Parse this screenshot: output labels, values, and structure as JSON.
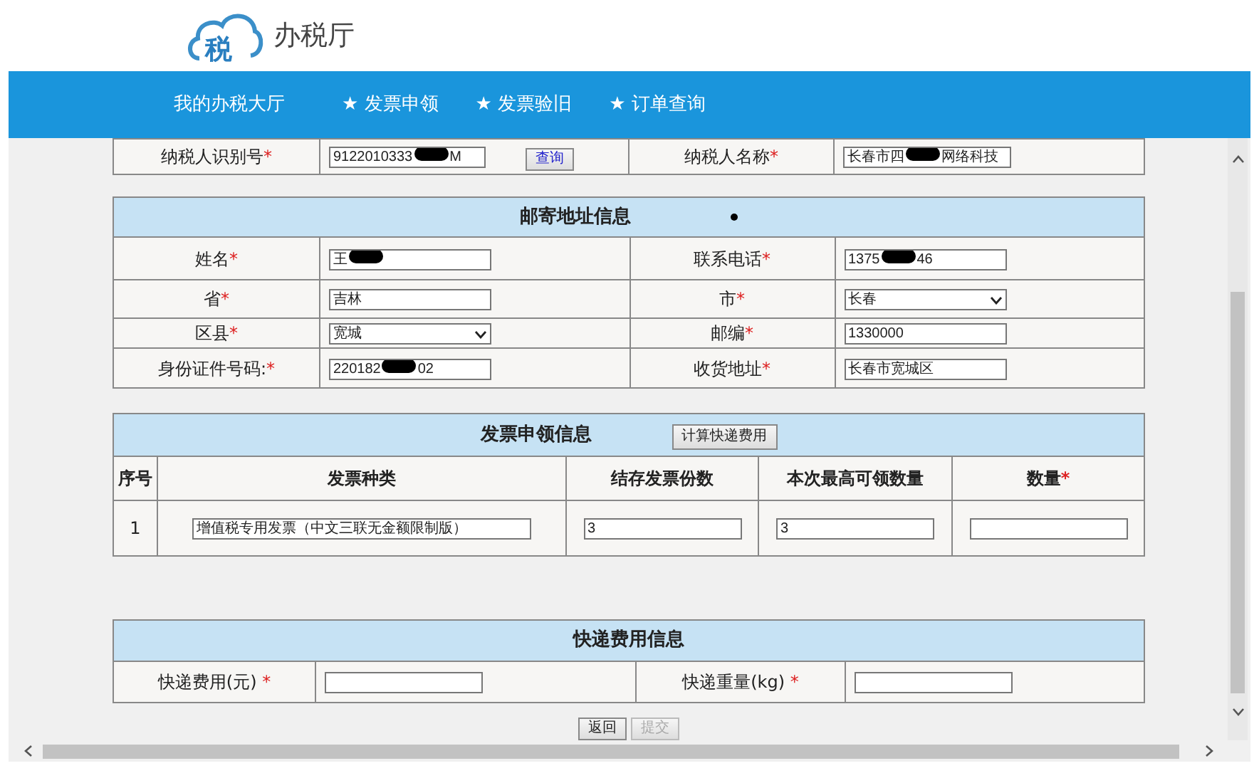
{
  "header": {
    "logo_glyph": "税",
    "title": "办税厅"
  },
  "nav": [
    {
      "label": "我的办税大厅"
    },
    {
      "star": "★",
      "label": "发票申领"
    },
    {
      "star": "★",
      "label": "发票验旧"
    },
    {
      "star": "★",
      "label": "订单查询"
    }
  ],
  "taxpayer": [
    {
      "label": "纳税人识别号",
      "mark": "*",
      "kind": "input",
      "value": [
        "9122010333",
        "M"
      ],
      "button": "查询"
    },
    {
      "label": "纳税人名称",
      "mark": "*",
      "kind": "input",
      "value": [
        "长春市四",
        "网络科技"
      ]
    }
  ],
  "mailing": {
    "title": "邮寄地址信息",
    "rows": [
      [
        {
          "label": "姓名",
          "mark": "*",
          "kind": "input",
          "value": [
            "王"
          ],
          "redacted_end": true
        },
        {
          "label": "联系电话",
          "mark": "*",
          "kind": "input",
          "value": [
            "1375",
            "46"
          ]
        }
      ],
      [
        {
          "label": "省",
          "mark": "*",
          "kind": "input",
          "value": [
            "吉林"
          ]
        },
        {
          "label": "市",
          "mark": "*",
          "kind": "select",
          "value": [
            "长春"
          ]
        }
      ],
      [
        {
          "label": "区县",
          "mark": "*",
          "kind": "select",
          "value": [
            "宽城"
          ]
        },
        {
          "label": "邮编",
          "mark": "*",
          "kind": "input",
          "value": [
            "1330000"
          ]
        }
      ],
      [
        {
          "label": "身份证件号码:",
          "mark": "*",
          "kind": "input",
          "value": [
            "220182",
            "02"
          ]
        },
        {
          "label": "收货地址",
          "mark": "*",
          "kind": "input",
          "value": [
            "长春市宽城区"
          ]
        }
      ]
    ]
  },
  "invoice": {
    "title": "发票申领信息",
    "button": "计算快递费用",
    "columns": [
      {
        "label": "序号"
      },
      {
        "label": "发票种类"
      },
      {
        "label": "结存发票份数"
      },
      {
        "label": "本次最高可领数量"
      },
      {
        "label": "数量",
        "mark": "*"
      }
    ],
    "rows": [
      {
        "index": "1",
        "type": "增值税专用发票（中文三联无金额限制版）",
        "stock": "3",
        "max": "3"
      }
    ]
  },
  "express": {
    "title": "快递费用信息",
    "fields": [
      {
        "label": "快递费用(元)",
        "mark": "*"
      },
      {
        "label": "快递重量(kg)",
        "mark": "*"
      }
    ]
  },
  "buttons": [
    {
      "label": "返回",
      "disabled": false
    },
    {
      "label": "提交",
      "disabled": true
    }
  ]
}
